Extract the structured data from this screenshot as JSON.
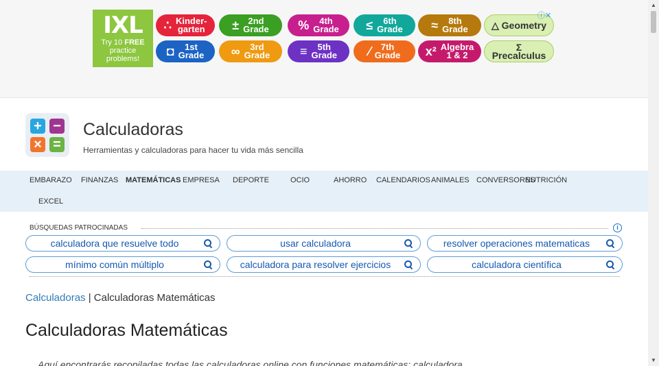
{
  "ad": {
    "brand": "IXL",
    "promo_line1": "Try 10",
    "promo_free": "FREE",
    "promo_line2": "practice",
    "promo_line3": "problems!",
    "close": "ⓘ✕",
    "grades": [
      {
        "label1": "Kinder-",
        "label2": "garten",
        "sym": "∴",
        "color": "#e5243b"
      },
      {
        "label1": "2nd",
        "label2": "Grade",
        "sym": "±",
        "color": "#3a9f22"
      },
      {
        "label1": "4th",
        "label2": "Grade",
        "sym": "%",
        "color": "#c71f8e"
      },
      {
        "label1": "6th",
        "label2": "Grade",
        "sym": "≤",
        "color": "#11a89b"
      },
      {
        "label1": "8th",
        "label2": "Grade",
        "sym": "≈",
        "color": "#b5790d"
      },
      {
        "label1": "△ Geometry",
        "label2": "",
        "sym": "",
        "color": "#d9efb3"
      },
      {
        "label1": "1st",
        "label2": "Grade",
        "sym": "◘",
        "color": "#1c63c4"
      },
      {
        "label1": "3rd",
        "label2": "Grade",
        "sym": "∞",
        "color": "#ef9a11"
      },
      {
        "label1": "5th",
        "label2": "Grade",
        "sym": "≡",
        "color": "#6d32c4"
      },
      {
        "label1": "7th",
        "label2": "Grade",
        "sym": "⁄",
        "color": "#f06c1d"
      },
      {
        "label1": "Algebra",
        "label2": "1 & 2",
        "sym": "x²",
        "color": "#c51a6c"
      },
      {
        "label1": "Σ Precalculus",
        "label2": "",
        "sym": "",
        "color": "#d9efb3"
      }
    ]
  },
  "site": {
    "title": "Calculadoras",
    "tagline": "Herramientas y calculadoras para hacer tu vida más sencilla",
    "logo_symbols": [
      "+",
      "−",
      "×",
      "="
    ]
  },
  "nav": {
    "items": [
      "EMBARAZO",
      "FINANZAS",
      "MATEMÁTICAS",
      "EMPRESA",
      "DEPORTE",
      "OCIO",
      "AHORRO",
      "CALENDARIOS",
      "ANIMALES",
      "CONVERSORES",
      "NUTRICIÓN",
      "EXCEL"
    ]
  },
  "sponsored": {
    "label": "BÚSQUEDAS PATROCINADAS",
    "searches": [
      "calculadora que resuelve todo",
      "usar calculadora",
      "resolver operaciones matematicas",
      "mínimo común múltiplo",
      "calculadora para resolver ejercicios",
      "calculadora científica"
    ]
  },
  "breadcrumb": {
    "home": "Calculadoras",
    "separator": " | ",
    "current": "Calculadoras Matemáticas"
  },
  "content": {
    "heading": "Calculadoras Matemáticas",
    "intro": "Aquí encontrarás recopiladas todas las calculadoras online con funciones matemáticas: calculadora"
  },
  "colors": {
    "accent": "#2f7ab8",
    "nav_bg": "#e6f0f8",
    "ixl_green": "#8dc63f"
  }
}
